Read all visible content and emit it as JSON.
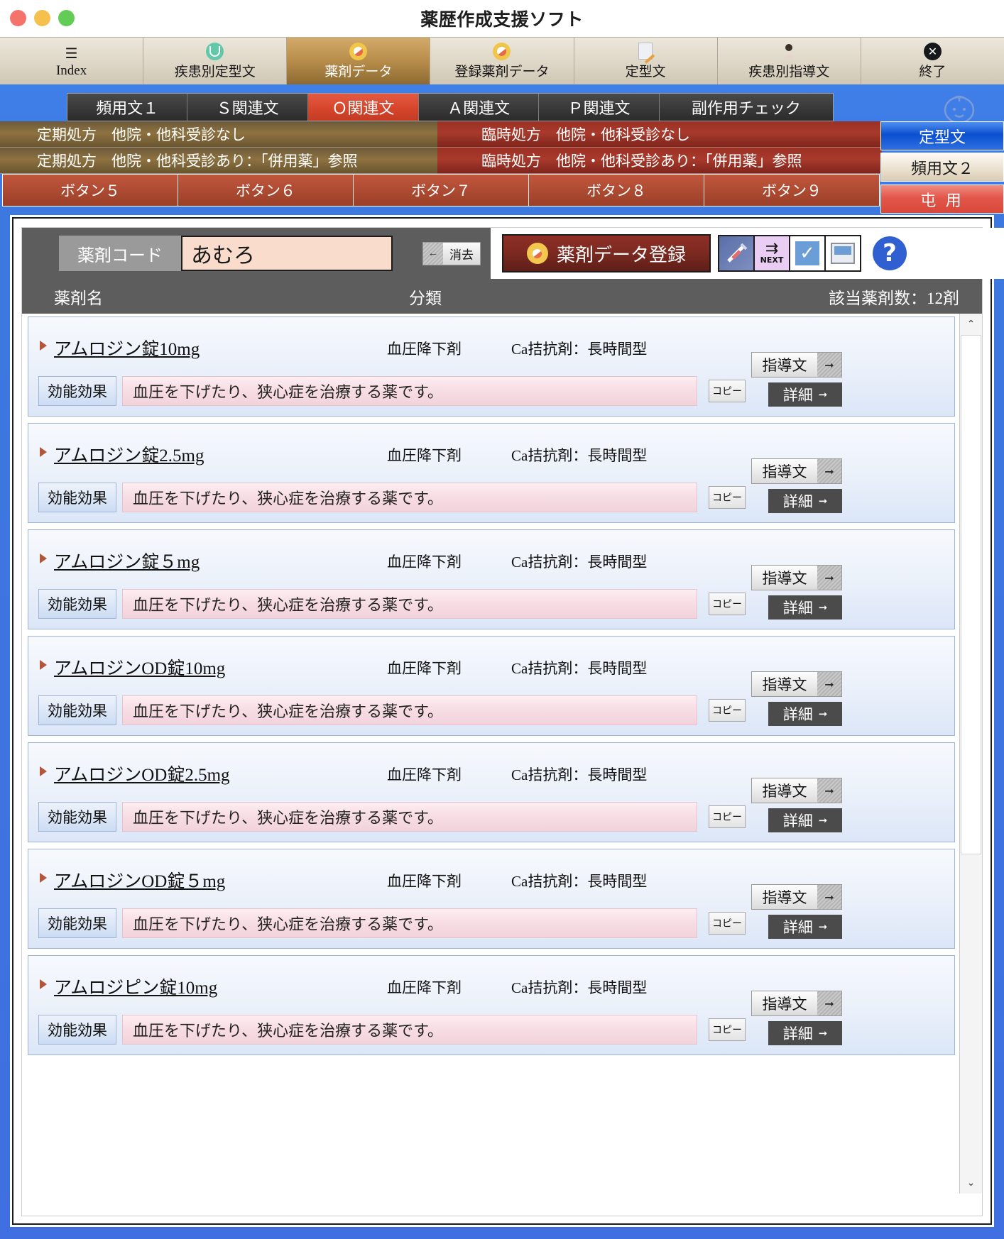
{
  "window": {
    "title": "薬歴作成支援ソフト"
  },
  "toolbar": {
    "items": [
      {
        "label": "Index",
        "icon": "list-icon"
      },
      {
        "label": "疾患別定型文",
        "icon": "stethoscope-icon"
      },
      {
        "label": "薬剤データ",
        "icon": "capsule-icon",
        "active": true
      },
      {
        "label": "登録薬剤データ",
        "icon": "capsule-icon"
      },
      {
        "label": "定型文",
        "icon": "memo-pencil-icon"
      },
      {
        "label": "疾患別指導文",
        "icon": "person-icon"
      },
      {
        "label": "終了",
        "icon": "close-circle-icon"
      }
    ]
  },
  "tabs": [
    {
      "label": "頻用文１",
      "active": false
    },
    {
      "label": "Ｓ関連文",
      "active": false
    },
    {
      "label": "Ｏ関連文",
      "active": true
    },
    {
      "label": "Ａ関連文",
      "active": false
    },
    {
      "label": "Ｐ関連文",
      "active": false
    },
    {
      "label": "副作用チェック",
      "active": false
    }
  ],
  "presets": {
    "left": [
      "定期処方　他院・他科受診なし",
      "定期処方　他院・他科受診あり：「併用薬」参照"
    ],
    "right": [
      "臨時処方　他院・他科受診なし",
      "臨時処方　他院・他科受診あり：「併用薬」参照"
    ],
    "buttons": [
      "ボタン５",
      "ボタン６",
      "ボタン７",
      "ボタン８",
      "ボタン９"
    ]
  },
  "side_buttons": [
    {
      "label": "定型文",
      "style": "blue"
    },
    {
      "label": "頻用文２",
      "style": "cream"
    },
    {
      "label": "屯 用",
      "style": "pink"
    }
  ],
  "search": {
    "code_label": "薬剤コード",
    "code_value": "あむろ",
    "clear_label": "消去",
    "clear_arrow": "←",
    "register_label": "薬剤データ登録",
    "icons": [
      "syringe-icon",
      "next-arrow-icon",
      "checkmark-icon",
      "monitor-icon"
    ],
    "next_label": "NEXT",
    "help_label": "?"
  },
  "columns": {
    "name": "薬剤名",
    "category": "分類",
    "count": "該当薬剤数：12剤"
  },
  "row_labels": {
    "efficacy": "効能効果",
    "copy": "コピー",
    "guide": "指導文",
    "detail": "詳細",
    "arrow": "➡"
  },
  "drugs": [
    {
      "name": "アムロジン錠10mg",
      "class1": "血圧降下剤",
      "class2": "Ca拮抗剤：長時間型",
      "efficacy": "血圧を下げたり、狭心症を治療する薬です。"
    },
    {
      "name": "アムロジン錠2.5mg",
      "class1": "血圧降下剤",
      "class2": "Ca拮抗剤：長時間型",
      "efficacy": "血圧を下げたり、狭心症を治療する薬です。"
    },
    {
      "name": "アムロジン錠５mg",
      "class1": "血圧降下剤",
      "class2": "Ca拮抗剤：長時間型",
      "efficacy": "血圧を下げたり、狭心症を治療する薬です。"
    },
    {
      "name": "アムロジンOD錠10mg",
      "class1": "血圧降下剤",
      "class2": "Ca拮抗剤：長時間型",
      "efficacy": "血圧を下げたり、狭心症を治療する薬です。"
    },
    {
      "name": "アムロジンOD錠2.5mg",
      "class1": "血圧降下剤",
      "class2": "Ca拮抗剤：長時間型",
      "efficacy": "血圧を下げたり、狭心症を治療する薬です。"
    },
    {
      "name": "アムロジンOD錠５mg",
      "class1": "血圧降下剤",
      "class2": "Ca拮抗剤：長時間型",
      "efficacy": "血圧を下げたり、狭心症を治療する薬です。"
    },
    {
      "name": "アムロジピン錠10mg",
      "class1": "血圧降下剤",
      "class2": "Ca拮抗剤：長時間型",
      "efficacy": "血圧を下げたり、狭心症を治療する薬です。"
    }
  ],
  "scrollbar": {
    "up": "⌃",
    "down": "⌄"
  },
  "colors": {
    "accent_blue": "#3f78e0",
    "tab_active_red": "#d8472e",
    "register_red": "#7e2a21",
    "toolbar_active": "#b98e4c"
  }
}
